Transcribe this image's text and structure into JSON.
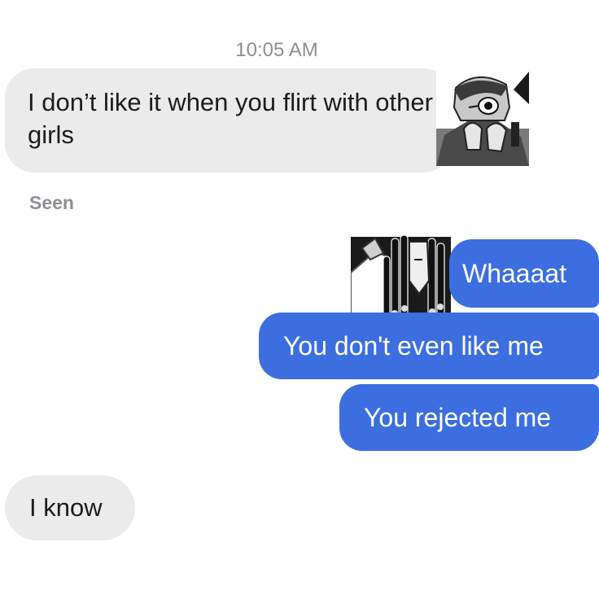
{
  "chat": {
    "timestamp": "10:05 AM",
    "messages": [
      {
        "sender": "them",
        "text": "I don’t like it when you flirt with other girls"
      },
      {
        "sender": "me",
        "text": "Whaaaat"
      },
      {
        "sender": "me",
        "text": "You don't even like me"
      },
      {
        "sender": "me",
        "text": "You rejected me"
      },
      {
        "sender": "them",
        "text": "I know"
      }
    ],
    "seen_label": "Seen"
  },
  "colors": {
    "incoming_bubble": "#ebebeb",
    "outgoing_bubble": "#3c6ee0",
    "meta_text": "#8e8e93"
  },
  "icons": {
    "avatar1": "manga-character-avatar-icon",
    "avatar2": "manga-dreadlocks-character-avatar-icon"
  }
}
